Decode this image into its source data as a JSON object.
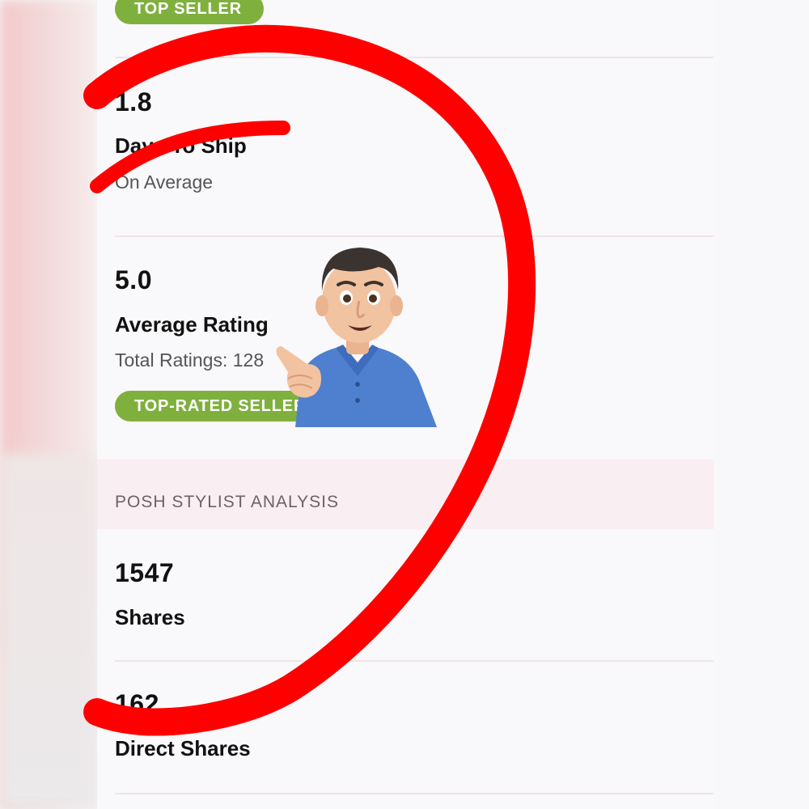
{
  "seller": {
    "badge_top": "TOP SELLER"
  },
  "ship": {
    "value": "1.8",
    "label": "Days To Ship",
    "sub": "On Average"
  },
  "rating": {
    "value": "5.0",
    "label": "Average Rating",
    "sub": "Total Ratings: 128",
    "badge": "TOP-RATED SELLER"
  },
  "section": {
    "title": "POSH STYLIST ANALYSIS"
  },
  "shares": {
    "value": "1547",
    "label": "Shares"
  },
  "direct_shares": {
    "value": "162",
    "label": "Direct Shares"
  },
  "colors": {
    "badge_green": "#7fb03d",
    "circle_red": "#ff0000",
    "section_band": "#f9eef2"
  },
  "icons": {
    "overlay_emoji": "man-pointing-emoji",
    "annotation": "red-circle-annotation"
  }
}
